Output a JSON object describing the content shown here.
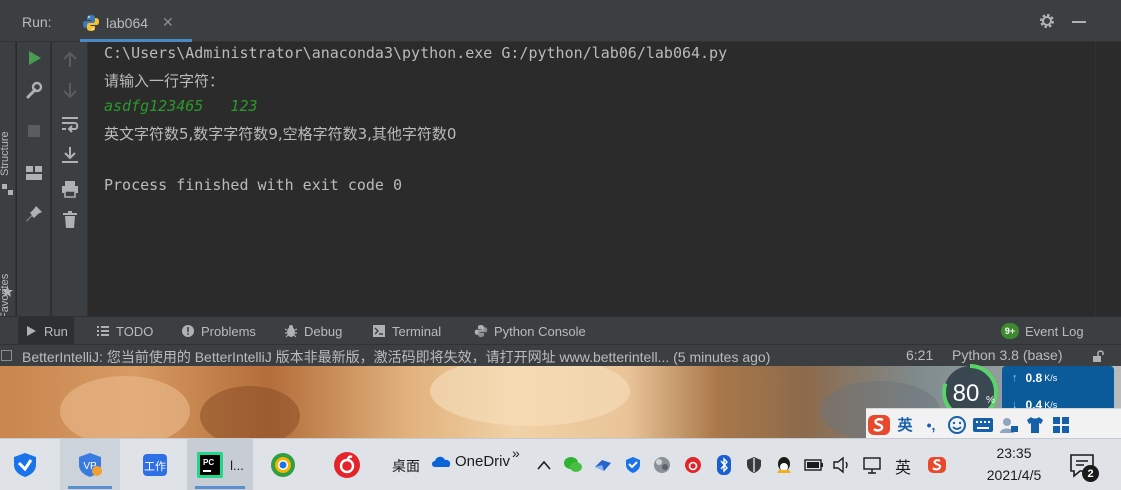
{
  "run_panel": {
    "label": "Run:",
    "tab_name": "lab064"
  },
  "side": {
    "structure": "Structure",
    "favorites": "Favorites"
  },
  "console": {
    "command": "C:\\Users\\Administrator\\anaconda3\\python.exe G:/python/lab06/lab064.py",
    "prompt": "请输入一行字符：",
    "user_input": "asdfg123465   123",
    "result": "英文字符数5,数字字符数9,空格字符数3,其他字符数0",
    "exit": "Process finished with exit code 0"
  },
  "toolbar": {
    "run": "Run",
    "todo": "TODO",
    "problems": "Problems",
    "debug": "Debug",
    "terminal": "Terminal",
    "python_console": "Python Console",
    "event_log": "Event Log",
    "event_badge": "9+"
  },
  "status_bar": {
    "message": "BetterIntelliJ: 您当前使用的 BetterIntelliJ 版本非最新版，激活码即将失效，请打开网址 www.betterintell... (5 minutes ago)",
    "position": "6:21",
    "interpreter": "Python 3.8 (base)"
  },
  "network_widget": {
    "percent": "80",
    "percent_unit": "%",
    "up_value": "0.8",
    "down_value": "0.4",
    "unit": "K/s"
  },
  "ime_bar": {
    "lang": "英",
    "punct": "•,"
  },
  "taskbar": {
    "pycharm_label": "l...",
    "desktop_label": "桌面",
    "onedrive_label": "OneDriv",
    "chevron": "»",
    "tray_lang": "英",
    "time": "23:35",
    "date": "2021/4/5",
    "notification_count": "2"
  },
  "colors": {
    "accent": "#4a88c7",
    "console_input": "#2a9a2a",
    "run_green": "#499c54",
    "badge_green": "#3e8a2e"
  }
}
